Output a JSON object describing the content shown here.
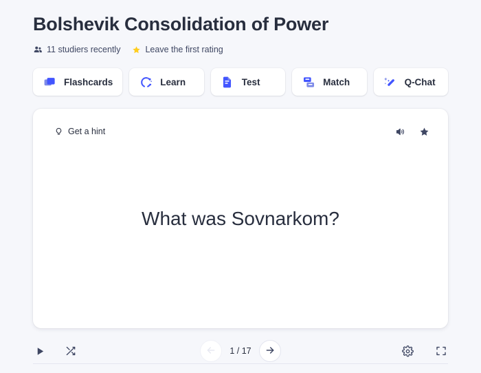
{
  "header": {
    "title": "Bolshevik Consolidation of Power",
    "studiers_text": "11 studiers recently",
    "studiers_icon": "people-icon",
    "rating_text": "Leave the first rating",
    "rating_icon": "star-icon",
    "rating_star_color": "#ffcd1f"
  },
  "modes": [
    {
      "label": "Flashcards",
      "icon": "flashcards-icon"
    },
    {
      "label": "Learn",
      "icon": "learn-icon"
    },
    {
      "label": "Test",
      "icon": "test-icon"
    },
    {
      "label": "Match",
      "icon": "match-icon"
    },
    {
      "label": "Q-Chat",
      "icon": "magic-wand-icon"
    }
  ],
  "card": {
    "hint_label": "Get a hint",
    "hint_icon": "lightbulb-icon",
    "audio_icon": "speaker-icon",
    "star_icon": "star-outline-icon",
    "term": "What was Sovnarkom?"
  },
  "toolbar": {
    "play_icon": "play-icon",
    "shuffle_icon": "shuffle-icon",
    "prev_icon": "arrow-left-icon",
    "next_icon": "arrow-right-icon",
    "counter": "1 / 17",
    "settings_icon": "gear-icon",
    "fullscreen_icon": "fullscreen-icon"
  },
  "colors": {
    "background": "#f6f7fb",
    "surface": "#ffffff",
    "text": "#282e3e",
    "accent": "#4255ff",
    "accent_light": "#7d8ae8",
    "star": "#ffcd1f",
    "muted": "#939bb4"
  }
}
